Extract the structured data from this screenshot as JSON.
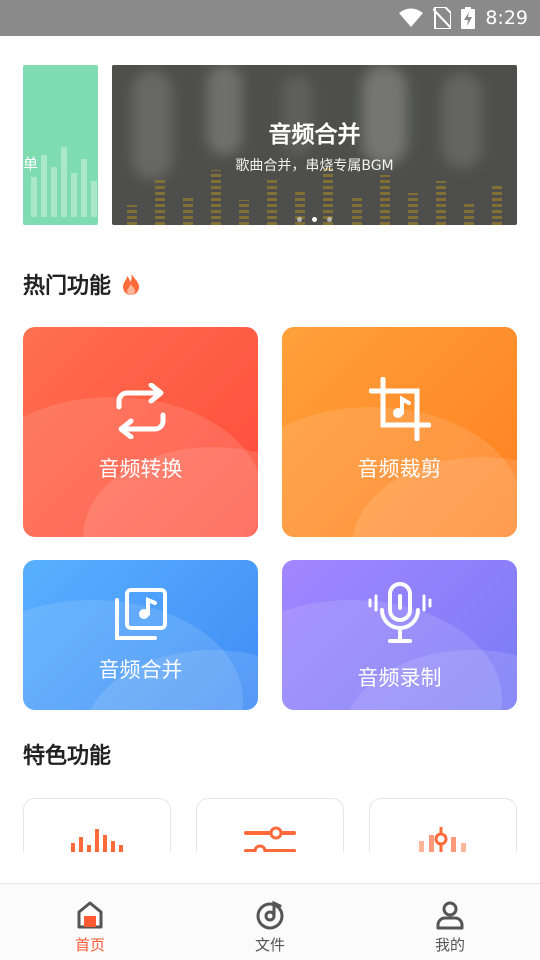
{
  "status_bar": {
    "time": "8:29"
  },
  "banner": {
    "prev_text": "单",
    "title": "音频合并",
    "subtitle": "歌曲合并，串烧专属BGM",
    "dots": 3,
    "active_dot": 1
  },
  "sections": {
    "hot": {
      "title": "热门功能"
    },
    "special": {
      "title": "特色功能"
    }
  },
  "hot_features": [
    {
      "label": "音频转换",
      "icon": "repeat-icon",
      "color": "#ff5a3f"
    },
    {
      "label": "音频裁剪",
      "icon": "crop-music-icon",
      "color": "#ff8f2a"
    },
    {
      "label": "音频合并",
      "icon": "music-library-icon",
      "color": "#4a9cfa"
    },
    {
      "label": "音频录制",
      "icon": "microphone-icon",
      "color": "#8d80fa"
    }
  ],
  "special_features": [
    {
      "icon": "equalizer-bars-icon",
      "color": "#ff6a3a"
    },
    {
      "icon": "sliders-icon",
      "color": "#ff6a3a"
    },
    {
      "icon": "mixer-icon",
      "color": "#ff9a7a"
    }
  ],
  "bottom_nav": [
    {
      "label": "首页",
      "icon": "home-icon",
      "active": true
    },
    {
      "label": "文件",
      "icon": "disc-icon",
      "active": false
    },
    {
      "label": "我的",
      "icon": "user-icon",
      "active": false
    }
  ],
  "colors": {
    "accent": "#ff5a33",
    "status_bar": "#8a8a8a"
  }
}
